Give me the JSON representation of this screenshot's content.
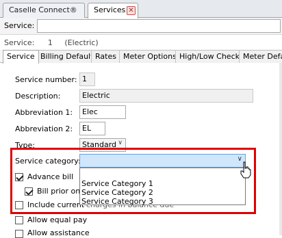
{
  "doc_tabs": [
    {
      "label": "Caselle Connect®"
    },
    {
      "label": "Services"
    }
  ],
  "search": {
    "label": "Service:",
    "value": ""
  },
  "service_info": {
    "label": "Service:",
    "number": "1",
    "name": "(Electric)"
  },
  "inner_tabs": [
    {
      "label": "Service"
    },
    {
      "label": "Billing Defaults"
    },
    {
      "label": "Rates"
    },
    {
      "label": "Meter Options"
    },
    {
      "label": "High/Low Checks"
    },
    {
      "label": "Meter Defau"
    }
  ],
  "form": {
    "service_number_label": "Service number:",
    "service_number_value": "1",
    "description_label": "Description:",
    "description_value": "Electric",
    "abbrev1_label": "Abbreviation 1:",
    "abbrev1_value": "Elec",
    "abbrev2_label": "Abbreviation 2:",
    "abbrev2_value": "EL",
    "type_label": "Type:",
    "type_value": "Standard",
    "service_category_label": "Service category:",
    "service_category_value": ""
  },
  "dropdown_options": [
    "Service Category 1",
    "Service Category 2",
    "Service Category 3"
  ],
  "checkboxes": {
    "advance_bill": {
      "label": "Advance bill",
      "checked": true
    },
    "bill_prior": {
      "label": "Bill prior on ne",
      "checked": true
    },
    "include_current": {
      "label": "Include current",
      "hidden_tail": "charges in balance due",
      "checked": false
    },
    "allow_equal_pay": {
      "label": "Allow equal pay",
      "checked": false
    },
    "allow_assistance": {
      "label": "Allow assistance",
      "checked": false
    }
  },
  "colors": {
    "highlight": "#e00000",
    "dropdown_selected_bg": "#cfe6fb"
  }
}
